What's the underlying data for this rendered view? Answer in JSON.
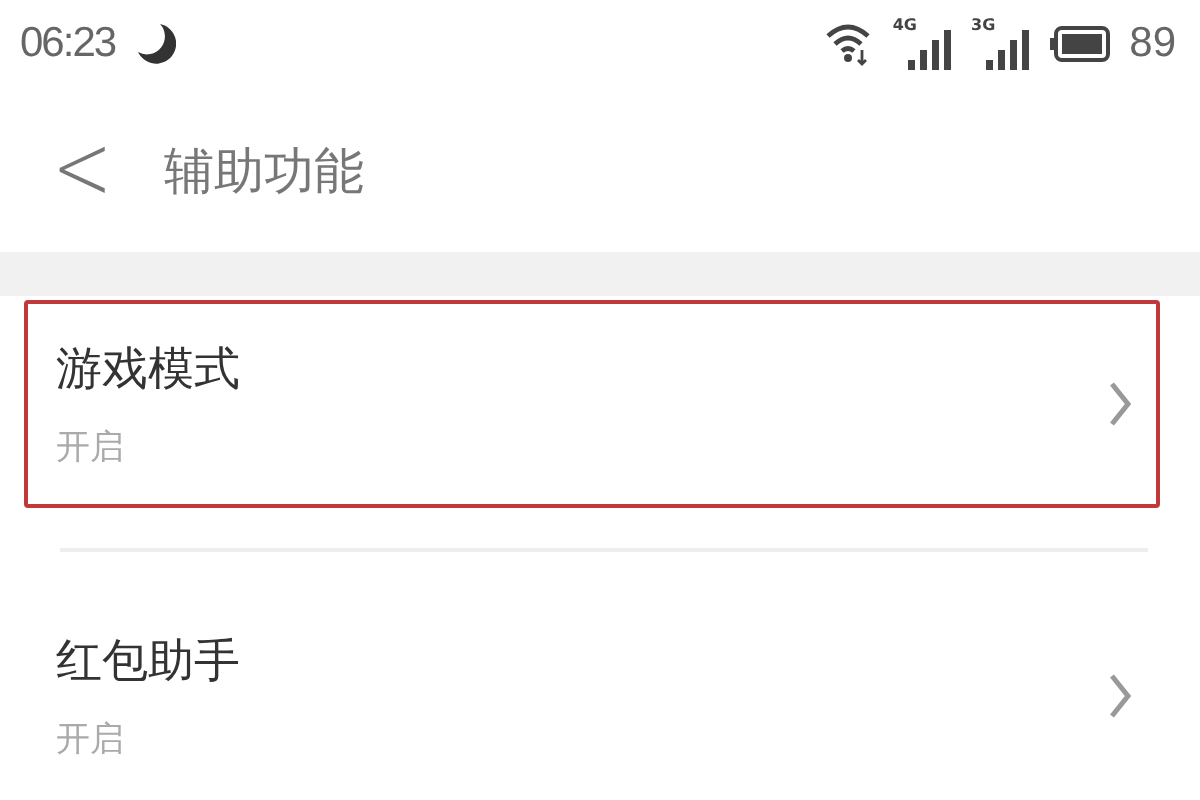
{
  "status_bar": {
    "time": "06:23",
    "signals": [
      {
        "network": "4G"
      },
      {
        "network": "3G"
      }
    ],
    "battery": "89"
  },
  "header": {
    "back": "<",
    "title": "辅助功能"
  },
  "items": [
    {
      "title": "游戏模式",
      "subtitle": "开启",
      "highlighted": true
    },
    {
      "title": "红包助手",
      "subtitle": "开启",
      "highlighted": false
    }
  ]
}
